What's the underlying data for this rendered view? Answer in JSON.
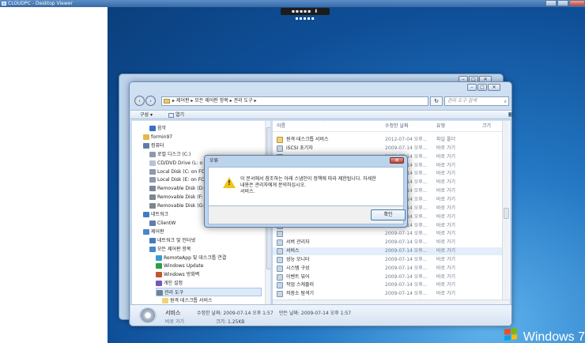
{
  "viewer": {
    "title": "CLOUDPC - Desktop Viewer",
    "handle": "▪▪▪▪▪ ⬇ ▪▪▪▪▪"
  },
  "desktop": {
    "brand": "Windows 7"
  },
  "explorer": {
    "breadcrumb": "▸ 제어판 ▸ 모든 제어판 항목 ▸ 관리 도구 ▸",
    "search_placeholder": "관리 도구 검색",
    "cmdbar": {
      "organize": "구성 ▾",
      "open": "열기"
    },
    "nav": [
      {
        "label": "음악",
        "indent": 1,
        "icon": "music-icon"
      },
      {
        "label": "formin97",
        "indent": 0,
        "icon": "user-folder-icon"
      },
      {
        "label": "컴퓨터",
        "indent": 0,
        "icon": "computer-icon"
      },
      {
        "label": "로컬 디스크 (C:)",
        "indent": 1,
        "icon": "disk-icon"
      },
      {
        "label": "CD/DVD Drive (L: o",
        "indent": 1,
        "icon": "cd-drive-icon"
      },
      {
        "label": "Local Disk (C: on FC",
        "indent": 1,
        "icon": "disk-icon"
      },
      {
        "label": "Local Disk (E: on FC",
        "indent": 1,
        "icon": "disk-icon"
      },
      {
        "label": "Removable Disk (D:",
        "indent": 1,
        "icon": "removable-disk-icon"
      },
      {
        "label": "Removable Disk (F:",
        "indent": 1,
        "icon": "removable-disk-icon"
      },
      {
        "label": "Removable Disk (G:",
        "indent": 1,
        "icon": "removable-disk-icon"
      },
      {
        "label": "네트워크",
        "indent": 0,
        "icon": "network-icon"
      },
      {
        "label": "ClientW",
        "indent": 1,
        "icon": "computer-icon"
      },
      {
        "label": "제어판",
        "indent": 0,
        "icon": "control-panel-icon"
      },
      {
        "label": "네트워크 및 인터넷",
        "indent": 1,
        "icon": "network-icon"
      },
      {
        "label": "모든 제어판 항목",
        "indent": 1,
        "icon": "control-panel-icon"
      },
      {
        "label": "RemoteApp 및 데스크톱 연결",
        "indent": 2,
        "icon": "remote-icon"
      },
      {
        "label": "Windows Update",
        "indent": 2,
        "icon": "update-icon"
      },
      {
        "label": "Windows 방화벽",
        "indent": 2,
        "icon": "firewall-icon"
      },
      {
        "label": "개인 설정",
        "indent": 2,
        "icon": "personalize-icon"
      },
      {
        "label": "관리 도구",
        "indent": 2,
        "icon": "admin-tools-icon",
        "selected": true
      },
      {
        "label": "원격 데스크톱 서비스",
        "indent": 3,
        "icon": "folder-icon"
      }
    ],
    "columns": {
      "name": "이름",
      "date": "수정한 날짜",
      "type": "유형",
      "size": "크기"
    },
    "files": [
      {
        "name": "원격 데스크톱 서비스",
        "date": "2012-07-04 오후...",
        "type": "파일 폴더",
        "folder": true
      },
      {
        "name": "iSCSI 초기자",
        "date": "2009-07-14 오후...",
        "type": "바로 가기"
      },
      {
        "name": "",
        "date": "2009-07-14 오후...",
        "type": "바로 가기"
      },
      {
        "name": "",
        "date": "2009-07-14 오후...",
        "type": "바로 가기"
      },
      {
        "name": "",
        "date": "2009-07-14 오후...",
        "type": "바로 가기"
      },
      {
        "name": "",
        "date": "2009-07-14 오후...",
        "type": "바로 가기"
      },
      {
        "name": "",
        "date": "2009-07-14 오후...",
        "type": "바로 가기"
      },
      {
        "name": "",
        "date": "2009-07-14 오후...",
        "type": "바로 가기"
      },
      {
        "name": "",
        "date": "2009-07-14 오후...",
        "type": "바로 가기"
      },
      {
        "name": "",
        "date": "2009-07-14 오후...",
        "type": "바로 가기"
      },
      {
        "name": "",
        "date": "2009-07-14 오후...",
        "type": "바로 가기"
      },
      {
        "name": "",
        "date": "2009-07-14 오후...",
        "type": "바로 가기"
      },
      {
        "name": "서버 관리자",
        "date": "2009-07-14 오후...",
        "type": "바로 가기"
      },
      {
        "name": "서비스",
        "date": "2009-07-14 오후...",
        "type": "바로 가기",
        "selected": true
      },
      {
        "name": "성능 모니터",
        "date": "2009-07-14 오후...",
        "type": "바로 가기"
      },
      {
        "name": "시스템 구성",
        "date": "2009-07-14 오후...",
        "type": "바로 가기"
      },
      {
        "name": "이벤트 뷰어",
        "date": "2009-07-14 오후...",
        "type": "바로 가기"
      },
      {
        "name": "작업 스케줄러",
        "date": "2009-07-14 오후...",
        "type": "바로 가기"
      },
      {
        "name": "저장소 탐색기",
        "date": "2009-07-14 오후...",
        "type": "바로 가기"
      },
      {
        "name": "컴퓨터 관리",
        "date": "2009-07-14 오후...",
        "type": "바로 가기"
      }
    ],
    "details": {
      "name": "서비스",
      "type": "바로 가기",
      "modified": "수정한 날짜: 2009-07-14 오후 1:57",
      "created": "만든 날짜: 2009-07-14 오후 1:57",
      "size": "크기: 1.25KB"
    }
  },
  "dialog": {
    "title": "오류",
    "close": "✕",
    "message_line1": "이 문서에서 참조하는 아래 스냅인이 정책에 따라 제한됩니다. 자세한",
    "message_line2": "내용은 관리자에게 문의하십시오.",
    "message_line3": "서비스.",
    "ok": "확인"
  }
}
